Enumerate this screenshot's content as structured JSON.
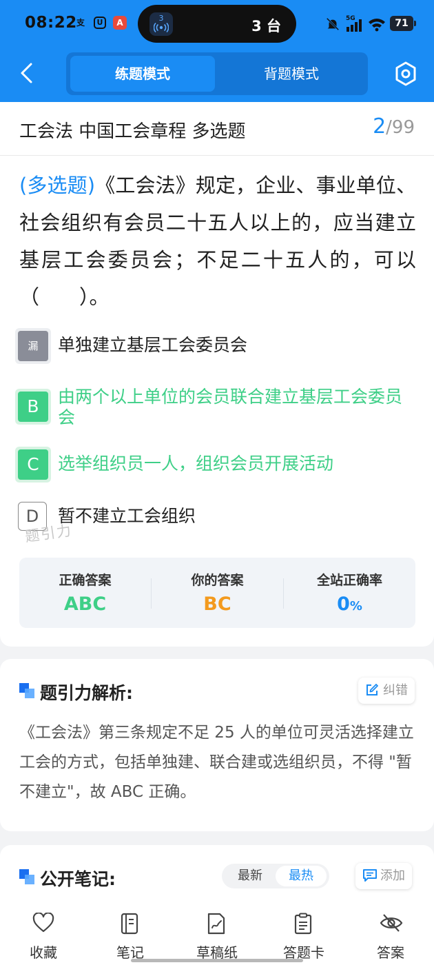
{
  "status_bar": {
    "time": "08:22",
    "left_icons": [
      "支",
      "U",
      "A"
    ],
    "island_app_label": "3",
    "island_text": "3 台",
    "network_label": "5G",
    "battery": "71"
  },
  "nav": {
    "tabs": [
      {
        "label": "练题模式",
        "active": true
      },
      {
        "label": "背题模式",
        "active": false
      }
    ]
  },
  "question": {
    "title": "工会法 中国工会章程 多选题",
    "current": "2",
    "total": "/99",
    "type_tag": "(多选题)",
    "stem": "《工会法》规定，企业、事业单位、社会组织有会员二十五人以上的，应当建立基层工会委员会；不足二十五人的，可以（　　）。",
    "options": [
      {
        "badge": "漏",
        "text": "单独建立基层工会委员会",
        "state": "missed"
      },
      {
        "badge": "B",
        "text": "由两个以上单位的会员联合建立基层工会委员会",
        "state": "correct"
      },
      {
        "badge": "C",
        "text": "选举组织员一人，组织会员开展活动",
        "state": "correct"
      },
      {
        "badge": "D",
        "text": "暂不建立工会组织",
        "state": "normal"
      }
    ],
    "watermark": "题引力"
  },
  "answers": {
    "correct_label": "正确答案",
    "correct_value": "ABC",
    "yours_label": "你的答案",
    "yours_value": "BC",
    "rate_label": "全站正确率",
    "rate_value": "0",
    "rate_unit": "%"
  },
  "analysis": {
    "title": "题引力解析:",
    "button": "纠错",
    "text": "《工会法》第三条规定不足 25 人的单位可灵活选择建立工会的方式，包括单独建、联合建或选组织员，不得 \"暂不建立\"，故 ABC 正确。"
  },
  "notes": {
    "title": "公开笔记:",
    "sort_options": [
      "最新",
      "最热"
    ],
    "add_button": "添加"
  },
  "bottom_bar": {
    "items": [
      {
        "label": "收藏",
        "icon": "heart-icon"
      },
      {
        "label": "笔记",
        "icon": "notebook-icon"
      },
      {
        "label": "草稿纸",
        "icon": "draft-icon"
      },
      {
        "label": "答题卡",
        "icon": "answer-sheet-icon"
      },
      {
        "label": "答案",
        "icon": "eye-off-icon"
      }
    ]
  },
  "colors": {
    "primary": "#1a8cf4",
    "correct": "#3ecf87",
    "yours": "#f39a1e",
    "missed_badge": "#8a8d98"
  }
}
